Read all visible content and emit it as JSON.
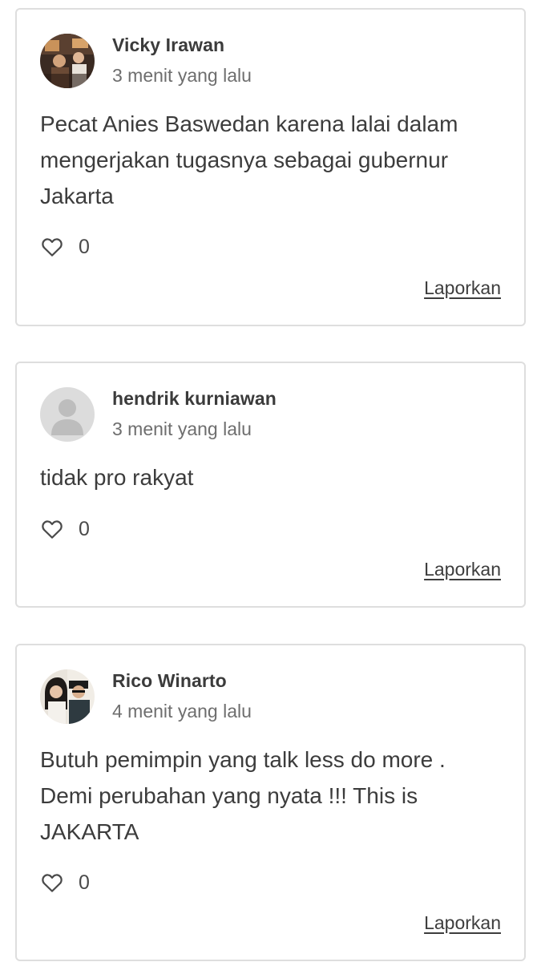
{
  "comments": [
    {
      "name": "Vicky Irawan",
      "time": "3 menit yang lalu",
      "text": "Pecat Anies Baswedan karena lalai dalam\nmengerjakan tugasnya sebagai gubernur\nJakarta",
      "likes": "0",
      "report_label": "Laporkan",
      "avatar_icon": "user-photo-icon"
    },
    {
      "name": "hendrik kurniawan",
      "time": "3 menit yang lalu",
      "text": "tidak pro rakyat",
      "likes": "0",
      "report_label": "Laporkan",
      "avatar_icon": "default-user-icon"
    },
    {
      "name": "Rico Winarto",
      "time": "4 menit yang lalu",
      "text": "Butuh pemimpin yang talk less do more .\nDemi perubahan yang nyata !!! This is\nJAKARTA",
      "likes": "0",
      "report_label": "Laporkan",
      "avatar_icon": "user-photo-icon"
    }
  ],
  "colors": {
    "border": "#dedede",
    "name": "#3b3b3b",
    "time": "#6e6e6e",
    "text": "#3c3c3c"
  }
}
